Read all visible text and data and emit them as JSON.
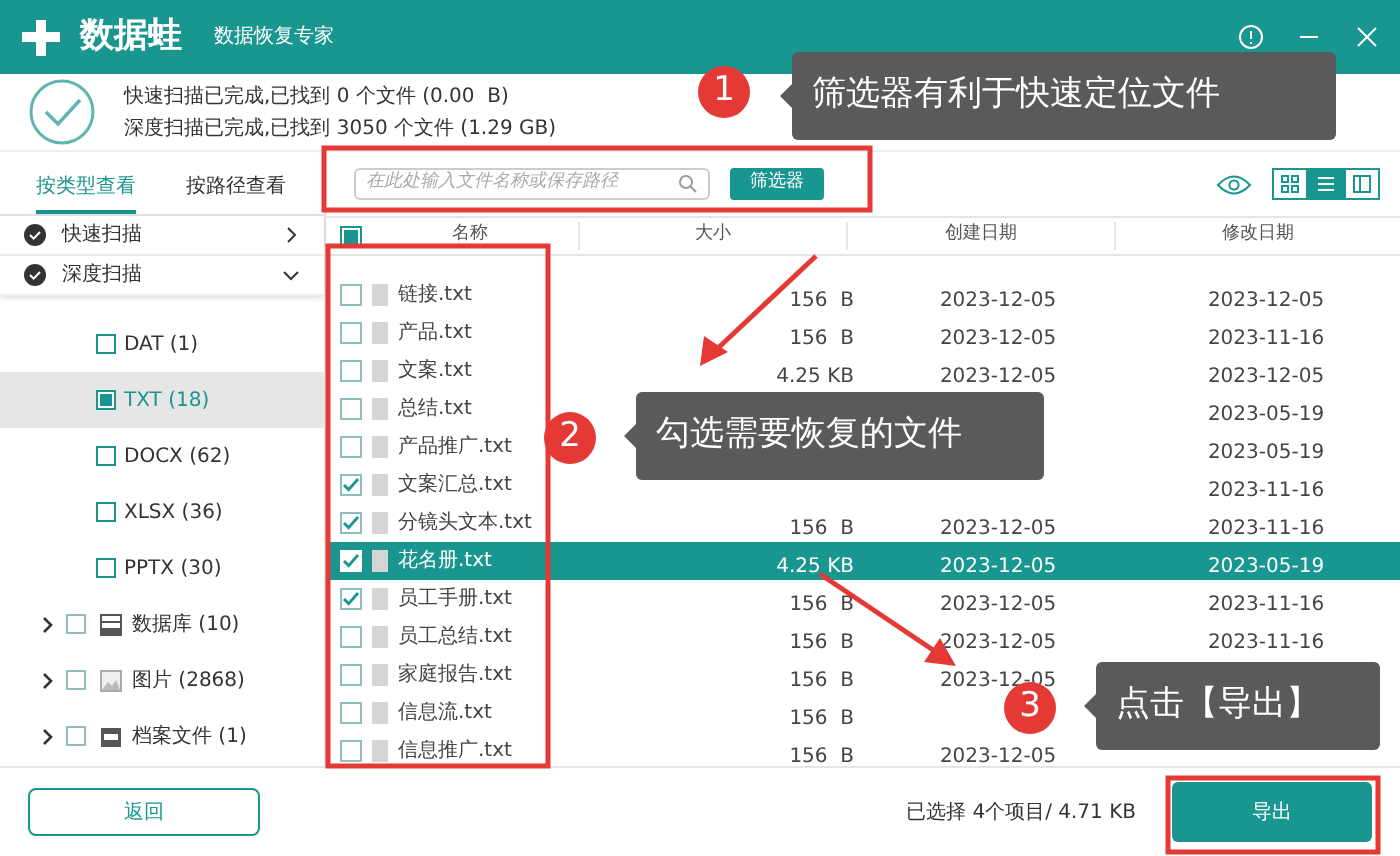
{
  "app": {
    "name": "数据蛙",
    "subtitle": "数据恢复专家"
  },
  "summary": {
    "lines": [
      "快速扫描已完成,已找到 0 个文件 (0.00  B)",
      "深度扫描已完成,已找到 3050 个文件 (1.29 GB)"
    ]
  },
  "view_tabs": [
    {
      "label": "按类型查看",
      "selected": true
    },
    {
      "label": "按路径查看",
      "selected": false
    }
  ],
  "scans": [
    {
      "label": "快速扫描",
      "expanded": false
    },
    {
      "label": "深度扫描",
      "expanded": true
    }
  ],
  "file_types": [
    {
      "label": "DAT (1)",
      "checked": false,
      "selected": false
    },
    {
      "label": "TXT (18)",
      "checked": true,
      "selected": true
    },
    {
      "label": "DOCX (62)",
      "checked": false,
      "selected": false
    },
    {
      "label": "XLSX (36)",
      "checked": false,
      "selected": false
    },
    {
      "label": "PPTX (30)",
      "checked": false,
      "selected": false
    }
  ],
  "categories": [
    {
      "label": "数据库 (10)",
      "kind": "database",
      "checked": false
    },
    {
      "label": "图片 (2868)",
      "kind": "image",
      "checked": false
    },
    {
      "label": "档案文件 (1)",
      "kind": "archive",
      "checked": false
    }
  ],
  "search": {
    "placeholder": "在此处输入文件名称或保存路径"
  },
  "filter_button": "筛选器",
  "view_modes": [
    {
      "kind": "grid",
      "selected": false
    },
    {
      "kind": "list",
      "selected": true
    },
    {
      "kind": "columns",
      "selected": false
    }
  ],
  "table": {
    "select_all_partial": true,
    "columns": [
      "名称",
      "大小",
      "创建日期",
      "修改日期"
    ],
    "rows": [
      {
        "name": "链接.txt",
        "size": "156  B",
        "created": "2023-12-05",
        "modified": "2023-12-05",
        "checked": false,
        "selected": false
      },
      {
        "name": "产品.txt",
        "size": "156  B",
        "created": "2023-12-05",
        "modified": "2023-11-16",
        "checked": false,
        "selected": false
      },
      {
        "name": "文案.txt",
        "size": "4.25 KB",
        "created": "2023-12-05",
        "modified": "2023-12-05",
        "checked": false,
        "selected": false
      },
      {
        "name": "总结.txt",
        "modified": "2023-05-19",
        "checked": false,
        "selected": false
      },
      {
        "name": "产品推广.txt",
        "modified": "2023-05-19",
        "checked": false,
        "selected": false
      },
      {
        "name": "文案汇总.txt",
        "modified": "2023-11-16",
        "checked": true,
        "selected": false
      },
      {
        "name": "分镜头文本.txt",
        "size": "156  B",
        "created": "2023-12-05",
        "modified": "2023-11-16",
        "checked": true,
        "selected": false
      },
      {
        "name": "花名册.txt",
        "size": "4.25 KB",
        "created": "2023-12-05",
        "modified": "2023-05-19",
        "checked": true,
        "selected": true
      },
      {
        "name": "员工手册.txt",
        "size": "156  B",
        "created": "2023-12-05",
        "modified": "2023-11-16",
        "checked": true,
        "selected": false
      },
      {
        "name": "员工总结.txt",
        "size": "156  B",
        "created": "2023-12-05",
        "modified": "2023-11-16",
        "checked": false,
        "selected": false
      },
      {
        "name": "家庭报告.txt",
        "size": "156  B",
        "created": "2023-12-05",
        "checked": false,
        "selected": false
      },
      {
        "name": "信息流.txt",
        "size": "156  B",
        "checked": false,
        "selected": false
      },
      {
        "name": "信息推广.txt",
        "size": "156  B",
        "created": "2023-12-05",
        "checked": false,
        "selected": false
      }
    ]
  },
  "back_button": "返回",
  "selection_status": "已选择 4个项目/ 4.71 KB",
  "export_button": "导出",
  "annotations": [
    {
      "number": "1",
      "text": "筛选器有利于快速定位文件"
    },
    {
      "number": "2",
      "text": "勾选需要恢复的文件"
    },
    {
      "number": "3",
      "text": "点击【导出】"
    }
  ]
}
